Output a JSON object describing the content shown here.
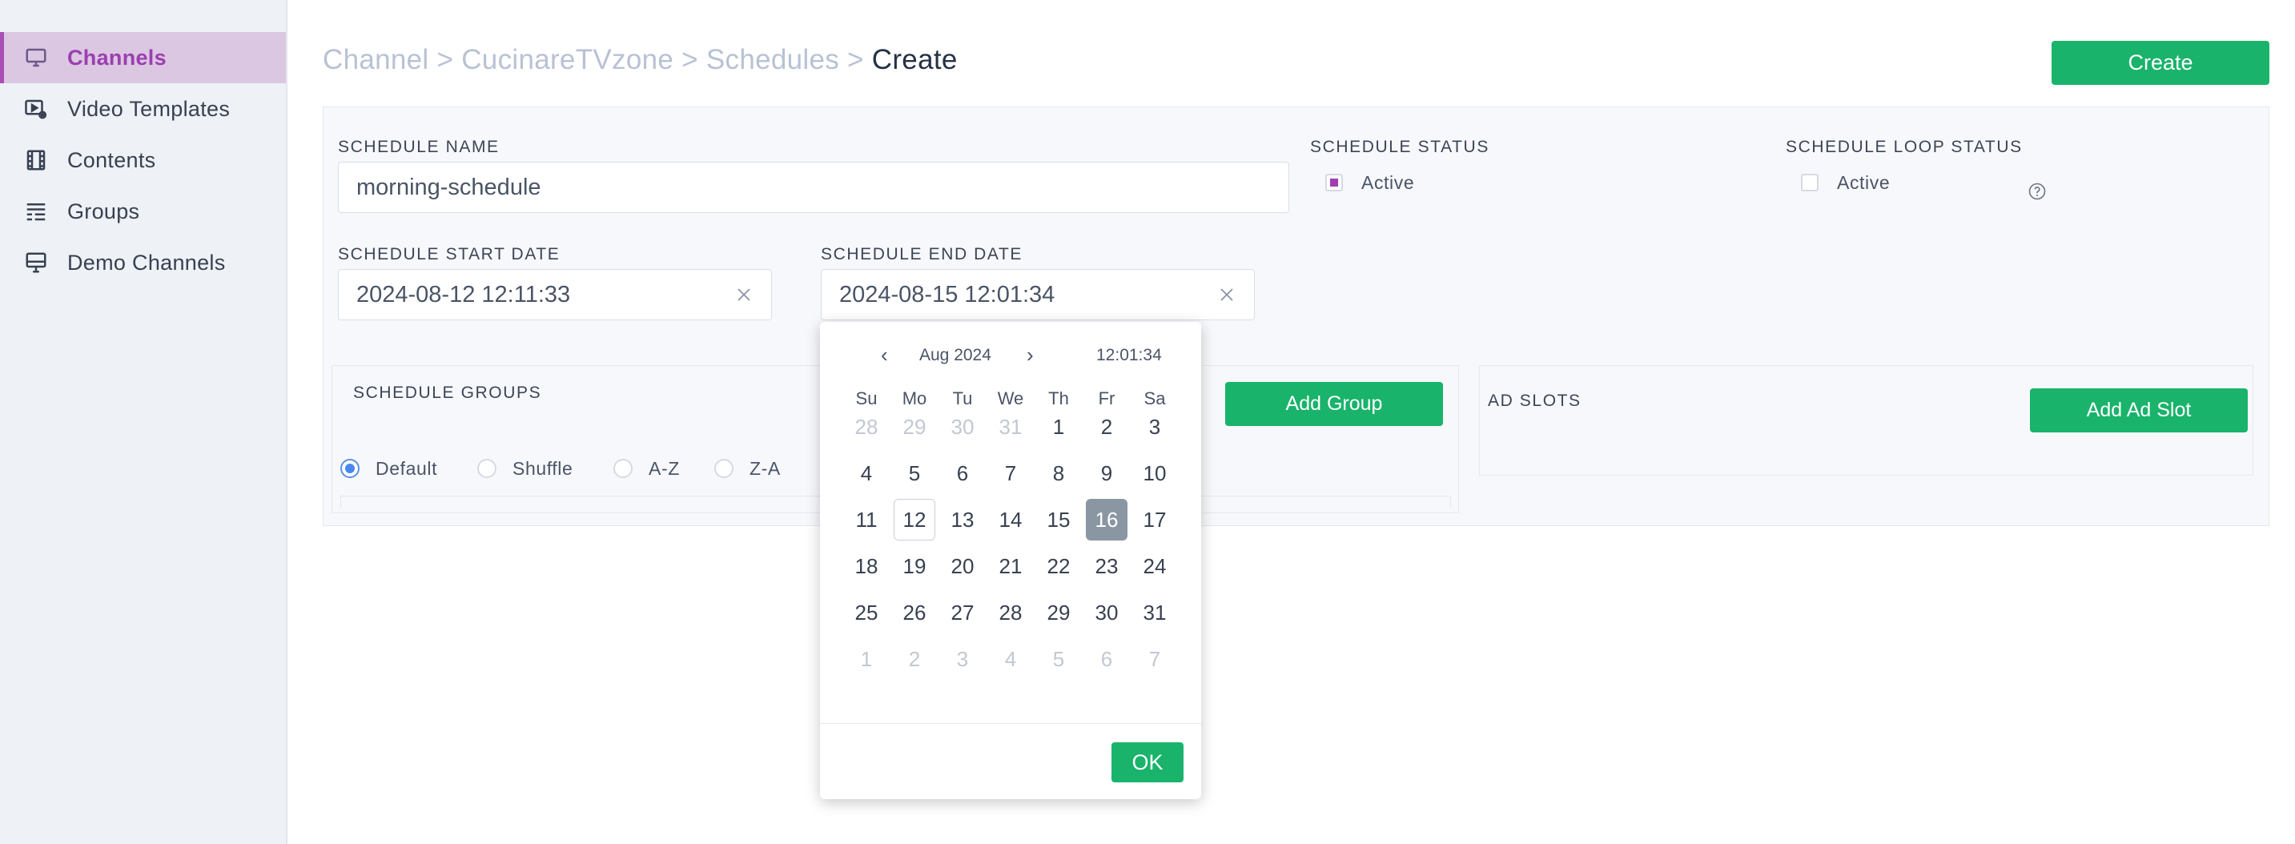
{
  "sidebar": {
    "items": [
      {
        "label": "Channels",
        "icon": "monitor-icon",
        "active": true
      },
      {
        "label": "Video Templates",
        "icon": "video-settings-icon"
      },
      {
        "label": "Contents",
        "icon": "film-strip-icon"
      },
      {
        "label": "Groups",
        "icon": "list-icon"
      },
      {
        "label": "Demo Channels",
        "icon": "tv-icon"
      }
    ]
  },
  "breadcrumb": {
    "items": [
      "Channel",
      "CucinareTVzone",
      "Schedules"
    ],
    "separator": ">",
    "current": "Create"
  },
  "header": {
    "create_label": "Create"
  },
  "form": {
    "schedule_name": {
      "label": "SCHEDULE NAME",
      "value": "morning-schedule"
    },
    "schedule_status": {
      "label": "SCHEDULE STATUS",
      "option": "Active",
      "checked": true
    },
    "loop_status": {
      "label": "SCHEDULE LOOP STATUS",
      "option": "Active",
      "checked": false
    },
    "start_date": {
      "label": "SCHEDULE START DATE",
      "value": "2024-08-12 12:11:33"
    },
    "end_date": {
      "label": "SCHEDULE END DATE",
      "value": "2024-08-15 12:01:34"
    }
  },
  "groups": {
    "title": "SCHEDULE GROUPS",
    "add_label": "Add Group",
    "options": [
      "Default",
      "Shuffle",
      "A-Z",
      "Z-A"
    ],
    "selected": "Default"
  },
  "ad_slots": {
    "title": "AD SLOTS",
    "add_label": "Add Ad Slot"
  },
  "picker": {
    "prev": "‹",
    "next": "›",
    "month": "Aug 2024",
    "time": "12:01:34",
    "weekdays": [
      "Su",
      "Mo",
      "Tu",
      "We",
      "Th",
      "Fr",
      "Sa"
    ],
    "weeks": [
      [
        "28",
        "29",
        "30",
        "31",
        "1",
        "2",
        "3"
      ],
      [
        "4",
        "5",
        "6",
        "7",
        "8",
        "9",
        "10"
      ],
      [
        "11",
        "12",
        "13",
        "14",
        "15",
        "16",
        "17"
      ],
      [
        "18",
        "19",
        "20",
        "21",
        "22",
        "23",
        "24"
      ],
      [
        "25",
        "26",
        "27",
        "28",
        "29",
        "30",
        "31"
      ],
      [
        "1",
        "2",
        "3",
        "4",
        "5",
        "6",
        "7"
      ]
    ],
    "today": "12",
    "selected": "16",
    "ok_label": "OK"
  },
  "colors": {
    "accent": "#a94fb5",
    "primary": "#19b36b",
    "selected_day": "#8b96a3"
  }
}
